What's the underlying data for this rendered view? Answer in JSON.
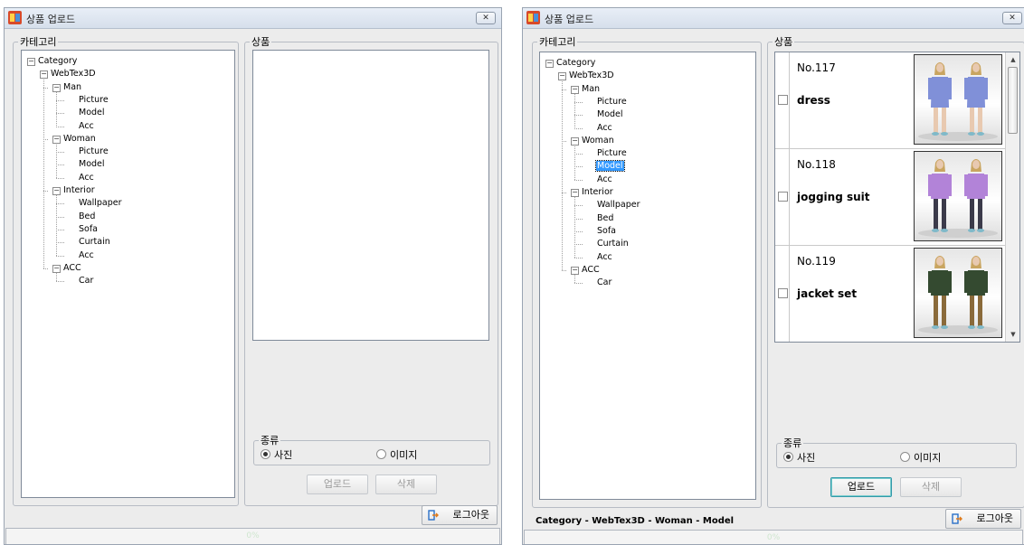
{
  "windows": [
    {
      "title": "상품 업로드",
      "close_label": "✕",
      "category_legend": "카테고리",
      "product_legend": "상품",
      "type_legend": "종류",
      "radio_photo": "사진",
      "radio_image": "이미지",
      "upload_label": "업로드",
      "delete_label": "삭제",
      "logout_label": "로그아웃",
      "status_path": "",
      "progress_text": "0%"
    },
    {
      "title": "상품 업로드",
      "close_label": "✕",
      "category_legend": "카테고리",
      "product_legend": "상품",
      "type_legend": "종류",
      "radio_photo": "사진",
      "radio_image": "이미지",
      "upload_label": "업로드",
      "delete_label": "삭제",
      "logout_label": "로그아웃",
      "status_path": "Category - WebTex3D - Woman - Model",
      "progress_text": "0%",
      "products": [
        {
          "no": "No.117",
          "name": "dress",
          "outfit": "dress"
        },
        {
          "no": "No.118",
          "name": "jogging suit",
          "outfit": "jogging"
        },
        {
          "no": "No.119",
          "name": "jacket set",
          "outfit": "jacket"
        }
      ],
      "selected_node": "Woman/Model"
    }
  ],
  "tree": [
    {
      "label": "Category",
      "toggle": "⊟"
    },
    {
      "label": "WebTex3D",
      "toggle": "⊟"
    },
    {
      "label": "Man",
      "toggle": "⊟"
    },
    {
      "label": "Picture"
    },
    {
      "label": "Model"
    },
    {
      "label": "Acc"
    },
    {
      "label": "Woman",
      "toggle": "⊟"
    },
    {
      "label": "Picture"
    },
    {
      "label": "Model"
    },
    {
      "label": "Acc"
    },
    {
      "label": "Interior",
      "toggle": "⊟"
    },
    {
      "label": "Wallpaper"
    },
    {
      "label": "Bed"
    },
    {
      "label": "Sofa"
    },
    {
      "label": "Curtain"
    },
    {
      "label": "Acc"
    },
    {
      "label": "ACC",
      "toggle": "⊟"
    },
    {
      "label": "Car"
    }
  ],
  "colors": {
    "window_bg": "#ececec",
    "selection": "#3399ff",
    "dress": "#8090d8",
    "jogging": "#b283d8",
    "jogging_pants": "#3b3a4a",
    "jacket": "#344a30",
    "jacket_pants": "#8a6a3a"
  }
}
